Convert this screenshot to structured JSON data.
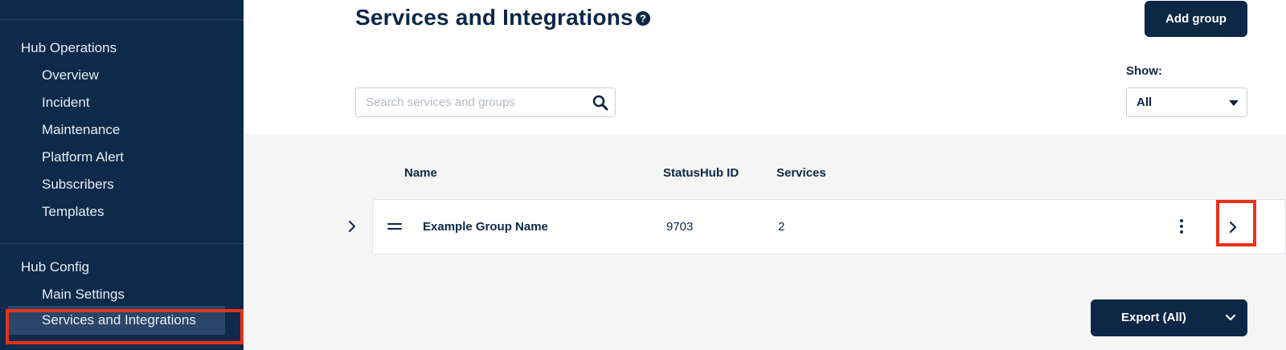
{
  "sidebar": {
    "sections": [
      {
        "title": "Hub Operations",
        "items": [
          "Overview",
          "Incident",
          "Maintenance",
          "Platform Alert",
          "Subscribers",
          "Templates"
        ]
      },
      {
        "title": "Hub Config",
        "items": [
          "Main Settings",
          "Services and Integrations"
        ]
      }
    ],
    "active_item": "Services and Integrations"
  },
  "header": {
    "title": "Services and Integrations",
    "help_icon": "question-circle-icon",
    "add_group_label": "Add group"
  },
  "filters": {
    "search_placeholder": "Search services and groups",
    "search_value": "",
    "show_label": "Show:",
    "show_value": "All"
  },
  "table": {
    "columns": [
      "Name",
      "StatusHub ID",
      "Services"
    ],
    "rows": [
      {
        "name": "Example Group Name",
        "statushub_id": "9703",
        "services": "2"
      }
    ]
  },
  "export": {
    "label": "Export (All)"
  },
  "colors": {
    "sidebar_bg": "#0d2a4a",
    "primary": "#0d2746",
    "highlight": "#e8321a",
    "table_bg": "#f5f5f5"
  }
}
